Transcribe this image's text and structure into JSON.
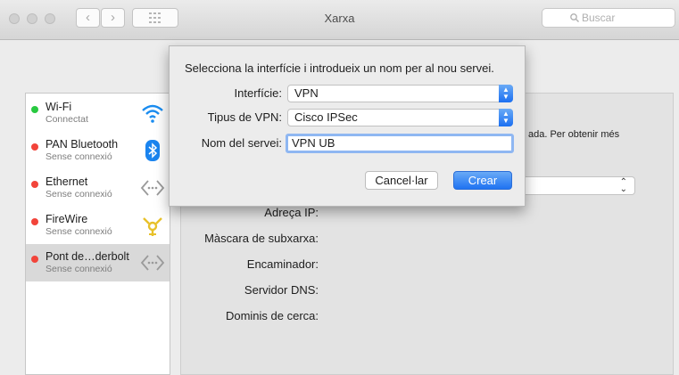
{
  "window": {
    "title": "Xarxa"
  },
  "search": {
    "placeholder": "Buscar"
  },
  "colors": {
    "green": "#28c940",
    "red": "#f2443a",
    "accent": "#1f73f2"
  },
  "services": [
    {
      "name": "Wi-Fi",
      "status": "Connectat",
      "status_color": "green",
      "icon": "wifi-icon"
    },
    {
      "name": "PAN Bluetooth",
      "status": "Sense connexió",
      "status_color": "red",
      "icon": "bluetooth-icon"
    },
    {
      "name": "Ethernet",
      "status": "Sense connexió",
      "status_color": "red",
      "icon": "ethernet-icon"
    },
    {
      "name": "FireWire",
      "status": "Sense connexió",
      "status_color": "red",
      "icon": "firewire-icon"
    },
    {
      "name": "Pont de…derbolt",
      "status": "Sense connexió",
      "status_color": "red",
      "icon": "thunderbolt-bridge-icon",
      "selected": true
    }
  ],
  "panel": {
    "description_fragment": "ada. Per obtenir més",
    "labels": {
      "ip": "Adreça IP:",
      "subnet": "Màscara de subxarxa:",
      "router": "Encaminador:",
      "dns": "Servidor DNS:",
      "search_domains": "Dominis de cerca:"
    }
  },
  "sheet": {
    "prompt": "Selecciona la interfície i introdueix un nom per al nou servei.",
    "interface_label": "Interfície:",
    "interface_value": "VPN",
    "vpn_type_label": "Tipus de VPN:",
    "vpn_type_value": "Cisco IPSec",
    "service_name_label": "Nom del servei:",
    "service_name_value": "VPN UB",
    "cancel_label": "Cancel·lar",
    "create_label": "Crear"
  }
}
